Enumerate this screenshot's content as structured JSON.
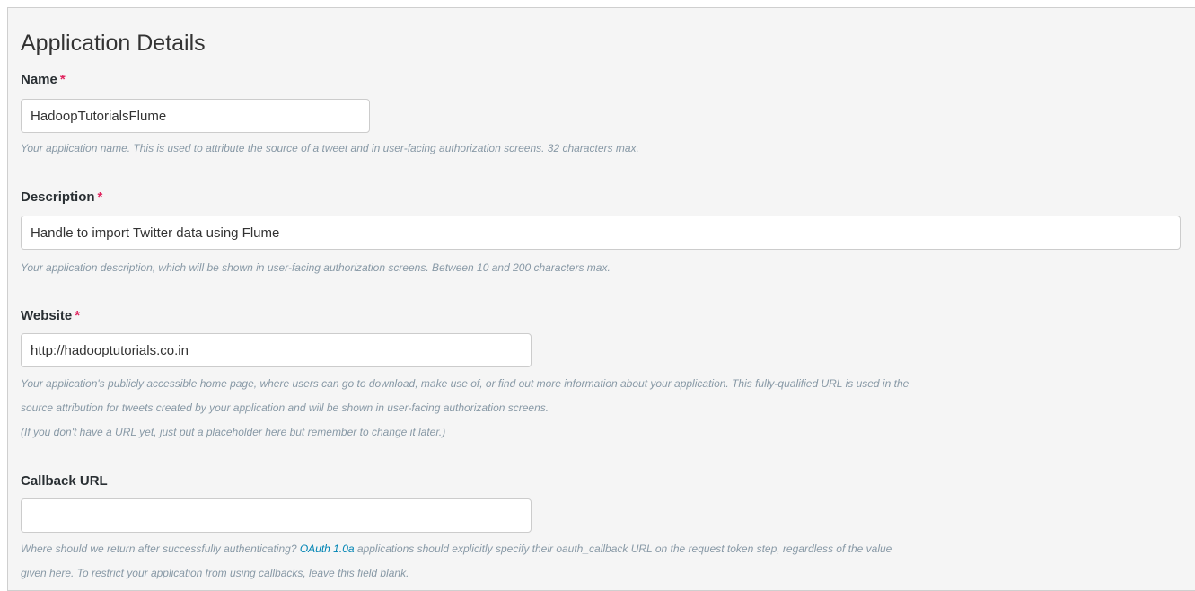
{
  "title": "Application Details",
  "required_marker": "*",
  "fields": {
    "name": {
      "label": "Name",
      "value": "HadoopTutorialsFlume",
      "help": "Your application name. This is used to attribute the source of a tweet and in user-facing authorization screens. 32 characters max."
    },
    "description": {
      "label": "Description",
      "value": "Handle to import Twitter data using Flume",
      "help": "Your application description, which will be shown in user-facing authorization screens. Between 10 and 200 characters max."
    },
    "website": {
      "label": "Website",
      "value": "http://hadooptutorials.co.in",
      "help_line1": "Your application's publicly accessible home page, where users can go to download, make use of, or find out more information about your application. This fully-qualified URL is used in the",
      "help_line2": "source attribution for tweets created by your application and will be shown in user-facing authorization screens.",
      "help_line3": "(If you don't have a URL yet, just put a placeholder here but remember to change it later.)"
    },
    "callback_url": {
      "label": "Callback URL",
      "value": "",
      "help_pre": "Where should we return after successfully authenticating? ",
      "help_link": "OAuth 1.0a",
      "help_post": " applications should explicitly specify their oauth_callback URL on the request token step, regardless of the value",
      "help_line2": "given here. To restrict your application from using callbacks, leave this field blank."
    }
  },
  "colors": {
    "background": "#f5f5f5",
    "required": "#e0245e",
    "help_text": "#8899a6",
    "link": "#0084b4"
  }
}
